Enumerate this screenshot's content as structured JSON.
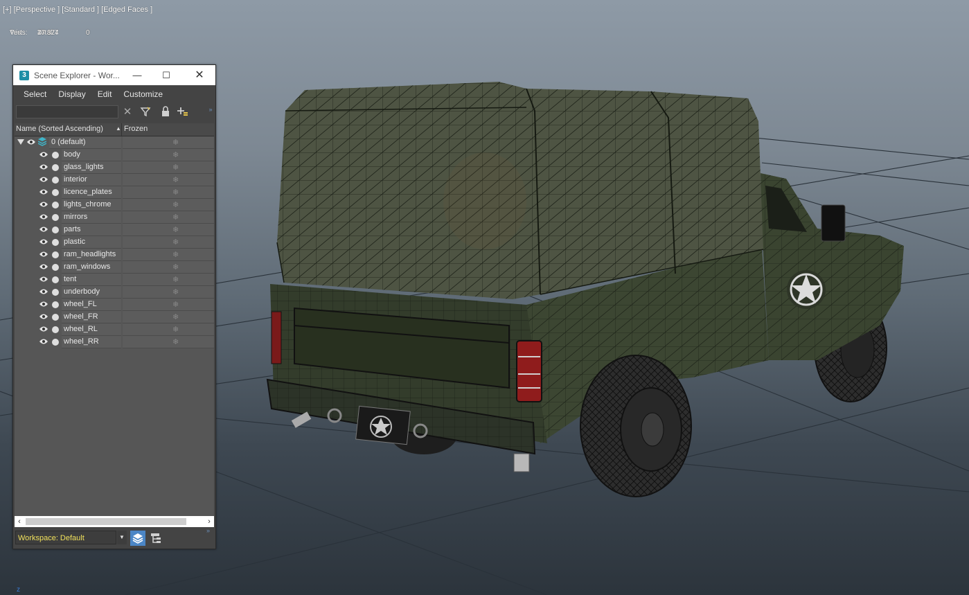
{
  "viewport": {
    "label": "[+] [Perspective ] [Standard ] [Edged Faces ]",
    "stats": {
      "header": "Total",
      "rows": [
        {
          "label": "Tris:",
          "total": "47 827",
          "selected": "0"
        },
        {
          "label": "Verts:",
          "total": "27 374",
          "selected": "0"
        }
      ]
    },
    "axis_label": "z"
  },
  "scene_explorer": {
    "app_icon": "3",
    "title": "Scene Explorer - Wor...",
    "window_controls": {
      "minimize": "—",
      "maximize": "☐",
      "close": "✕"
    },
    "menu": [
      "Select",
      "Display",
      "Edit",
      "Customize"
    ],
    "search": {
      "value": "",
      "placeholder": ""
    },
    "toolbar_icons": [
      "clear-icon",
      "filter-icon",
      "lock-icon",
      "add-layer-icon"
    ],
    "columns": {
      "name": "Name (Sorted Ascending)",
      "frozen": "Frozen"
    },
    "layer": {
      "label": "0 (default)"
    },
    "objects": [
      "body",
      "glass_lights",
      "interior",
      "licence_plates",
      "lights_chrome",
      "mirrors",
      "parts",
      "plastic",
      "ram_headlights",
      "ram_windows",
      "tent",
      "underbody",
      "wheel_FL",
      "wheel_FR",
      "wheel_RL",
      "wheel_RR"
    ],
    "workspace": "Workspace: Default"
  },
  "colors": {
    "accent": "#4b86c6",
    "workspace_text": "#f1e15c",
    "truck_body": "#3c4632",
    "tent": "#4e5443"
  }
}
